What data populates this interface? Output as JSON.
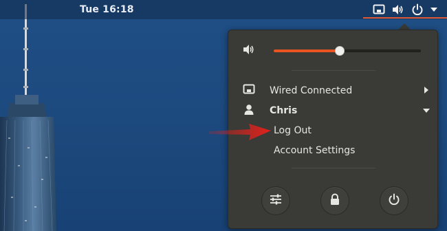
{
  "top_panel": {
    "clock": "Tue 16:18",
    "icons": [
      "network-wired-icon",
      "volume-icon",
      "power-icon",
      "menu-chevron-down-icon"
    ],
    "accent": "#e05a38"
  },
  "system_menu": {
    "volume": {
      "icon": "volume-icon",
      "level": 0.45,
      "accent": "#e95420"
    },
    "network": {
      "label": "Wired Connected",
      "icon": "network-wired-icon",
      "trail_icon": "chevron-right-icon"
    },
    "user": {
      "name": "Chris",
      "icon": "user-icon",
      "trail_icon": "chevron-down-icon",
      "items": [
        {
          "label": "Log Out"
        },
        {
          "label": "Account Settings"
        }
      ]
    },
    "actions": [
      {
        "icon": "settings-sliders-icon"
      },
      {
        "icon": "lock-icon"
      },
      {
        "icon": "power-icon"
      }
    ]
  },
  "annotation": {
    "arrow_color": "#e3211c"
  }
}
